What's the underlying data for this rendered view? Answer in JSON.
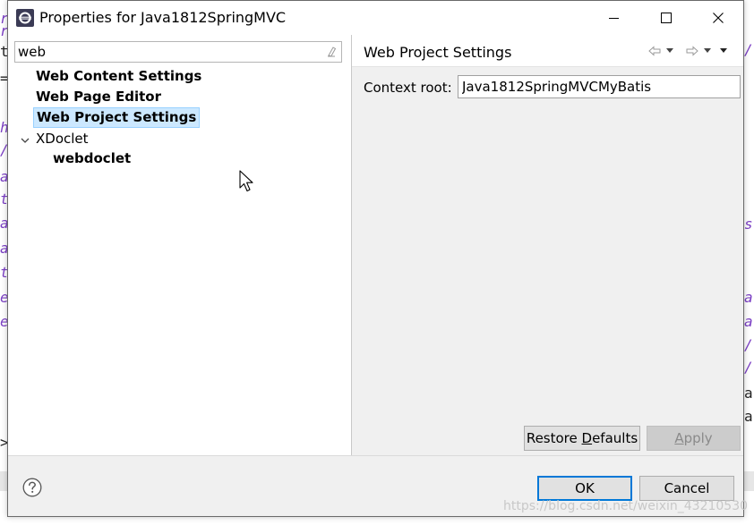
{
  "window": {
    "title": "Properties for Java1812SpringMVC"
  },
  "filter": {
    "value": "web"
  },
  "tree": {
    "items": [
      {
        "label": "Web Content Settings"
      },
      {
        "label": "Web Page Editor"
      },
      {
        "label": "Web Project Settings"
      },
      {
        "label": "XDoclet"
      },
      {
        "label": "webdoclet"
      }
    ]
  },
  "page": {
    "title": "Web Project Settings",
    "context_root_label": "Context root:",
    "context_root_value": "Java1812SpringMVCMyBatis"
  },
  "buttons": {
    "restore_pre": "Restore ",
    "restore_mnemonic": "D",
    "restore_post": "efaults",
    "apply_pre": "",
    "apply_mnemonic": "A",
    "apply_post": "pply",
    "ok": "OK",
    "cancel": "Cancel"
  },
  "watermark": "https://blog.csdn.net/weixin_43210530",
  "colors": {
    "selection_bg": "#cce8ff",
    "default_button_border": "#0078d7"
  },
  "icons": [
    "eclipse-app-icon",
    "minimize-icon",
    "maximize-icon",
    "close-icon",
    "clear-filter-icon",
    "expand-chevron-icon",
    "back-arrow-icon",
    "forward-arrow-icon",
    "view-menu-icon",
    "help-icon",
    "mouse-cursor-icon"
  ]
}
